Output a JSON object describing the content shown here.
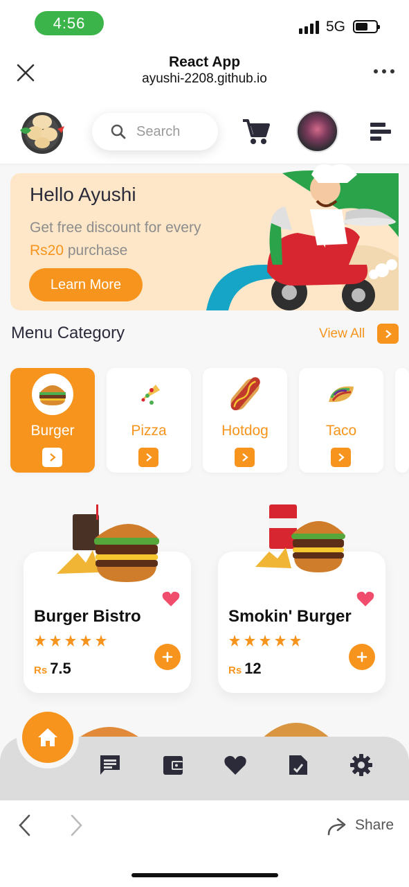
{
  "status": {
    "time": "4:56",
    "network": "5G"
  },
  "browser": {
    "title": "React App",
    "url": "ayushi-2208.github.io",
    "share_label": "Share"
  },
  "header": {
    "search_placeholder": "Search"
  },
  "banner": {
    "greeting": "Hello Ayushi",
    "line1": "Get free discount for every",
    "amount": "Rs20",
    "line2_suffix": " purchase",
    "cta": "Learn More"
  },
  "menu": {
    "title": "Menu Category",
    "view_all": "View All",
    "categories": [
      {
        "label": "Burger",
        "icon": "burger-icon",
        "active": true
      },
      {
        "label": "Pizza",
        "icon": "pizza-icon"
      },
      {
        "label": "Hotdog",
        "icon": "hotdog-icon"
      },
      {
        "label": "Taco",
        "icon": "taco-icon"
      }
    ]
  },
  "products": [
    {
      "name": "Burger Bistro",
      "currency": "Rs",
      "price": "7.5",
      "rating": 5
    },
    {
      "name": "Smokin' Burger",
      "currency": "Rs",
      "price": "12",
      "rating": 5
    }
  ],
  "nav": {
    "items": [
      "home-icon",
      "chat-icon",
      "wallet-icon",
      "heart-icon",
      "document-icon",
      "settings-icon"
    ]
  },
  "colors": {
    "accent": "#f7941d",
    "status_pill": "#3bb54a",
    "heart": "#ef4d6b"
  }
}
